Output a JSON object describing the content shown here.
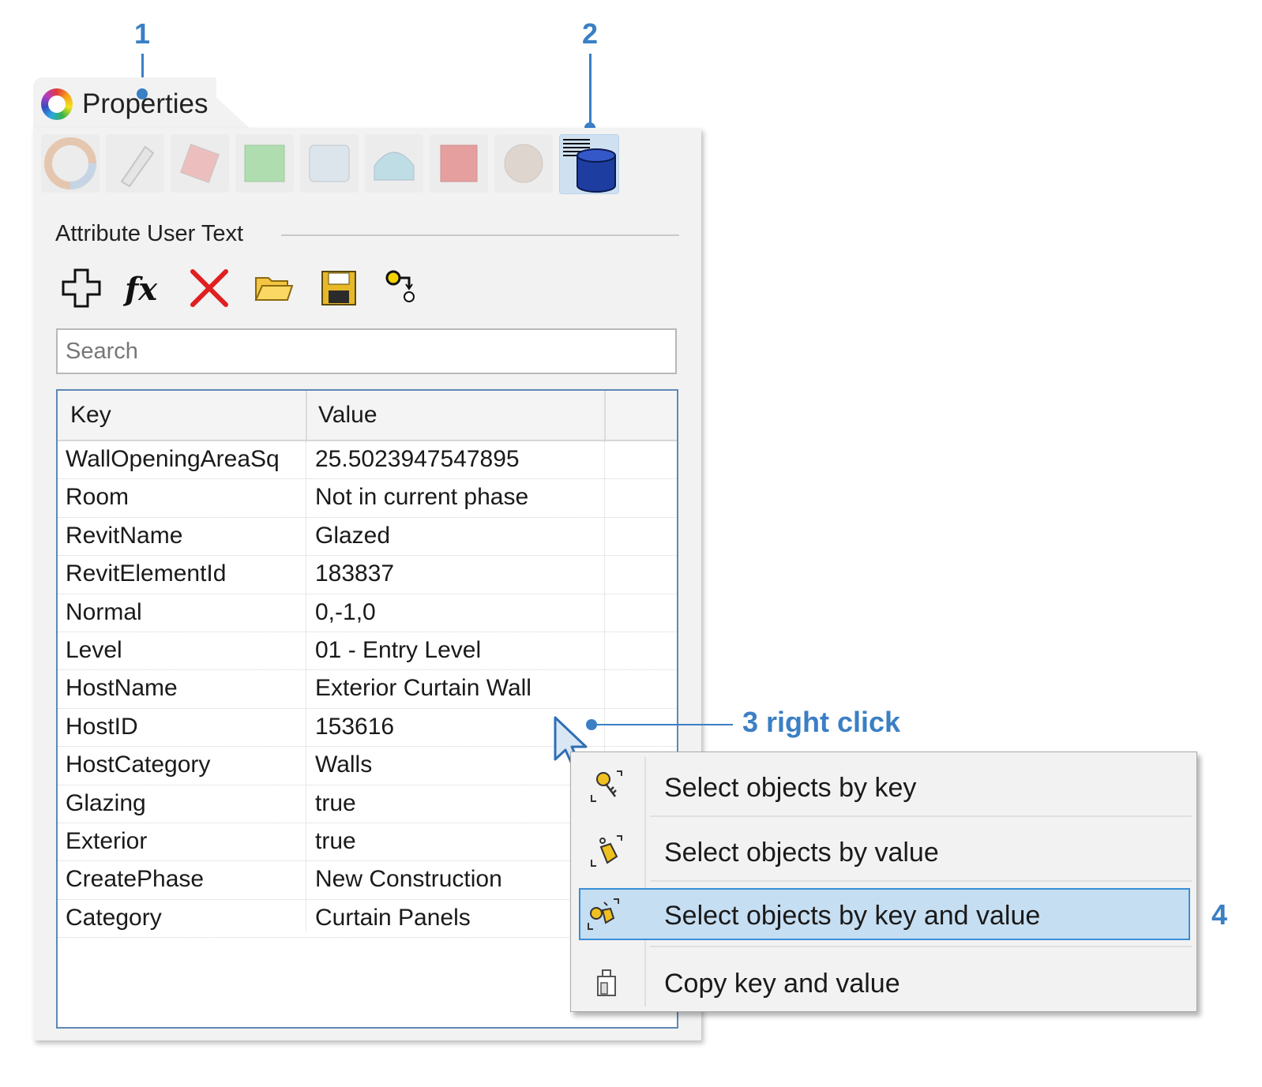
{
  "callouts": {
    "c1": "1",
    "c2": "2",
    "c3": "3 right click",
    "c4": "4"
  },
  "panel": {
    "tab_title": "Properties",
    "section_title": "Attribute User Text",
    "iconbar": [
      "object-properties-icon",
      "material-icon",
      "texture-mapping-icon",
      "decal-icon",
      "display-mode-icon",
      "shading-icon",
      "light-icon",
      "displacement-icon",
      "attribute-user-text-icon"
    ],
    "toolbar": [
      "add-icon",
      "formula-icon",
      "delete-icon",
      "open-folder-icon",
      "save-icon",
      "key-sequence-icon"
    ],
    "search": {
      "placeholder": "Search"
    },
    "grid": {
      "header_key": "Key",
      "header_value": "Value",
      "rows": [
        {
          "key": "WallOpeningAreaSq",
          "value": "25.5023947547895"
        },
        {
          "key": "Room",
          "value": "Not in current phase"
        },
        {
          "key": "RevitName",
          "value": "Glazed"
        },
        {
          "key": "RevitElementId",
          "value": "183837"
        },
        {
          "key": "Normal",
          "value": "0,-1,0"
        },
        {
          "key": "Level",
          "value": "01 - Entry Level"
        },
        {
          "key": "HostName",
          "value": "Exterior Curtain Wall"
        },
        {
          "key": "HostID",
          "value": "153616"
        },
        {
          "key": "HostCategory",
          "value": "Walls"
        },
        {
          "key": "Glazing",
          "value": "true"
        },
        {
          "key": "Exterior",
          "value": "true"
        },
        {
          "key": "CreatePhase",
          "value": "New Construction"
        },
        {
          "key": "Category",
          "value": "Curtain Panels"
        }
      ]
    }
  },
  "context_menu": {
    "items": [
      {
        "label": "Select objects by key",
        "icon": "key-select-icon"
      },
      {
        "label": "Select objects by value",
        "icon": "tag-select-icon"
      },
      {
        "label": "Select objects by key and value",
        "icon": "key-tag-select-icon",
        "highlighted": true
      },
      {
        "label": "Copy key and value",
        "icon": "copy-icon"
      }
    ]
  },
  "colors": {
    "accent": "#3b7fc4",
    "highlight": "#c6def2",
    "highlight_border": "#3a8ed6"
  }
}
